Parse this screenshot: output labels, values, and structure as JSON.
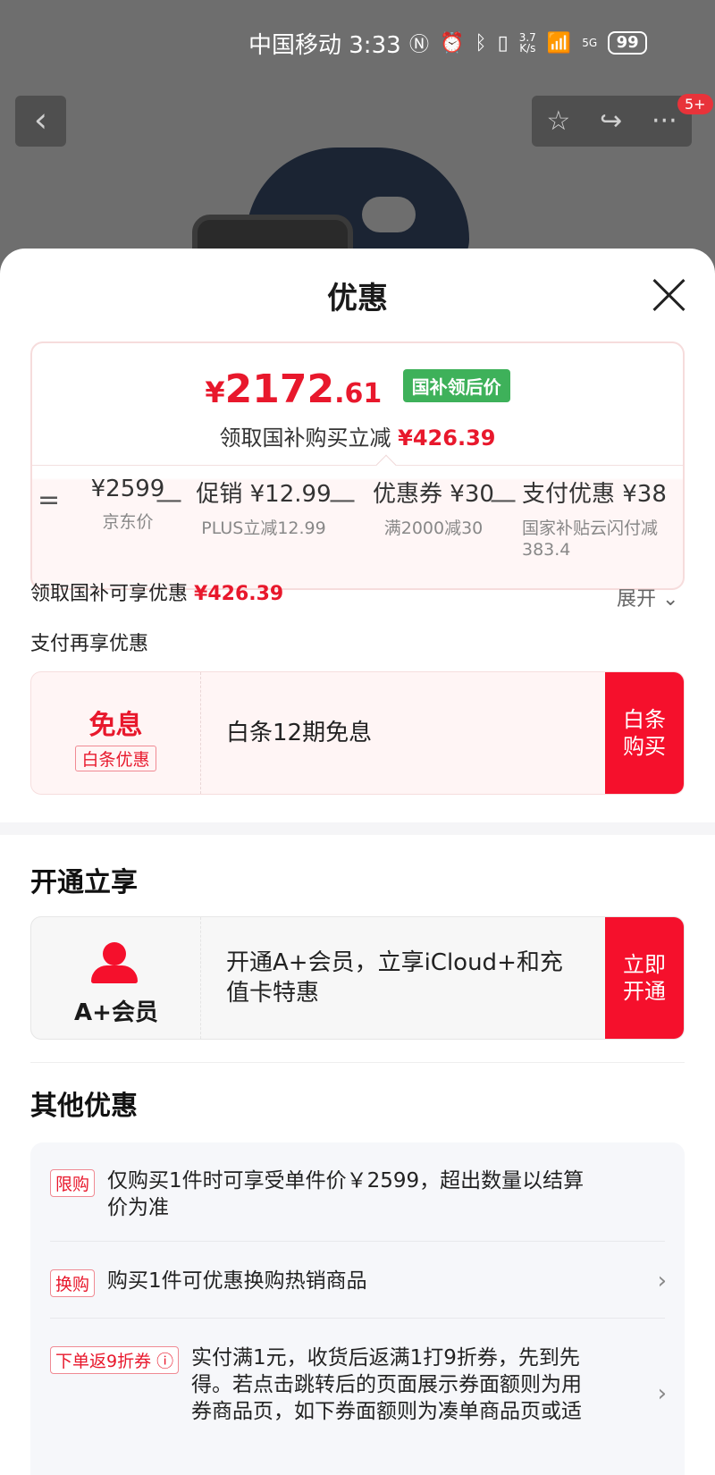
{
  "status_bar": {
    "carrier_time": "中国移动 3:33",
    "net_speed_top": "3.7",
    "net_speed_bottom": "K/s",
    "signal": "5G",
    "battery": "99"
  },
  "top_nav": {
    "back_glyph": "‹",
    "badge": "5+"
  },
  "sheet": {
    "title": "优惠",
    "price_card": {
      "currency": "¥",
      "price_int": "2172",
      "price_dec": ".61",
      "tag": "国补领后价",
      "sub_text": "领取国补购买立减",
      "sub_amount": "¥426.39",
      "breakdown": [
        {
          "value": "¥2599",
          "note": "京东价"
        },
        {
          "value": "促销 ¥12.99",
          "note": "PLUS立减12.99"
        },
        {
          "value": "优惠券 ¥30",
          "note": "满2000减30"
        },
        {
          "value": "支付优惠 ¥38",
          "note_line1": "国家补贴云闪付减",
          "note_line2": "383.4"
        }
      ],
      "operators": [
        "=",
        "—",
        "—",
        "—"
      ]
    },
    "guobu_total_label": "领取国补可享优惠",
    "guobu_total_amount": "¥426.39",
    "expand_label": "展开",
    "pay_section_title": "支付再享优惠",
    "baitiao": {
      "title": "免息",
      "tag": "白条优惠",
      "desc": "白条12期免息",
      "button_line1": "白条",
      "button_line2": "购买"
    },
    "membership_section_title": "开通立享",
    "membership": {
      "name": "A+会员",
      "desc_line1": "开通A+会员，立享iCloud+和充",
      "desc_line2": "值卡特惠",
      "button_line1": "立即",
      "button_line2": "开通"
    },
    "other_section_title": "其他优惠",
    "other_rows": [
      {
        "tag": "限购",
        "text_line1": "仅购买1件时可享受单件价￥2599，超出数量以结算",
        "text_line2": "价为准"
      },
      {
        "tag": "换购",
        "text_line1": "购买1件可优惠换购热销商品"
      },
      {
        "tag": "下单返9折券 ⓘ",
        "text_line1": "实付满1元，收货后返满1打9折券，先到先",
        "text_line2": "得。若点击跳转后的页面展示券面额则为用",
        "text_line3": "券商品页，如下券面额则为凑单商品页或适"
      }
    ]
  },
  "colors": {
    "accent_red": "#e8182c",
    "button_red": "#f5102c",
    "tag_green": "#3eb15a"
  }
}
